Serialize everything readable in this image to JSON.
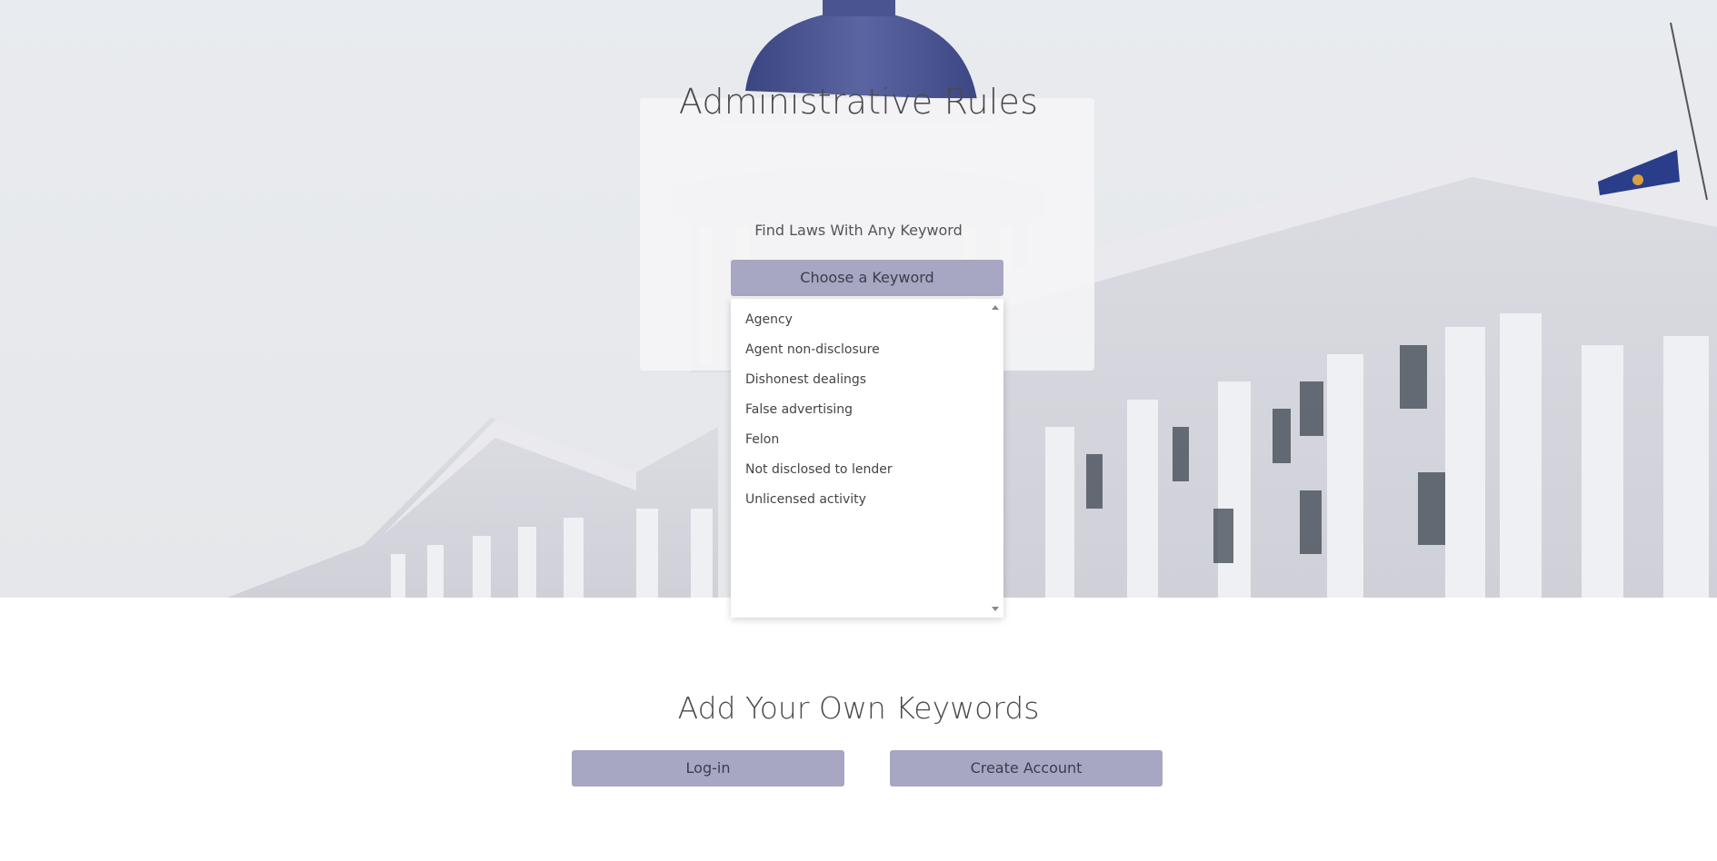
{
  "hero": {
    "title": "Administrative Rules",
    "subtitle": "Find Laws With Any Keyword",
    "dropdown_label": "Choose a Keyword",
    "keywords": [
      "Agency",
      "Agent non-disclosure",
      "Dishonest dealings",
      "False advertising",
      "Felon",
      "Not disclosed to lender",
      "Unlicensed activity"
    ]
  },
  "account": {
    "title": "Add Your Own Keywords",
    "login_label": "Log-in",
    "create_label": "Create Account"
  },
  "colors": {
    "button": "#a7a7c3",
    "dome": "#4a5590",
    "text": "#444444"
  }
}
